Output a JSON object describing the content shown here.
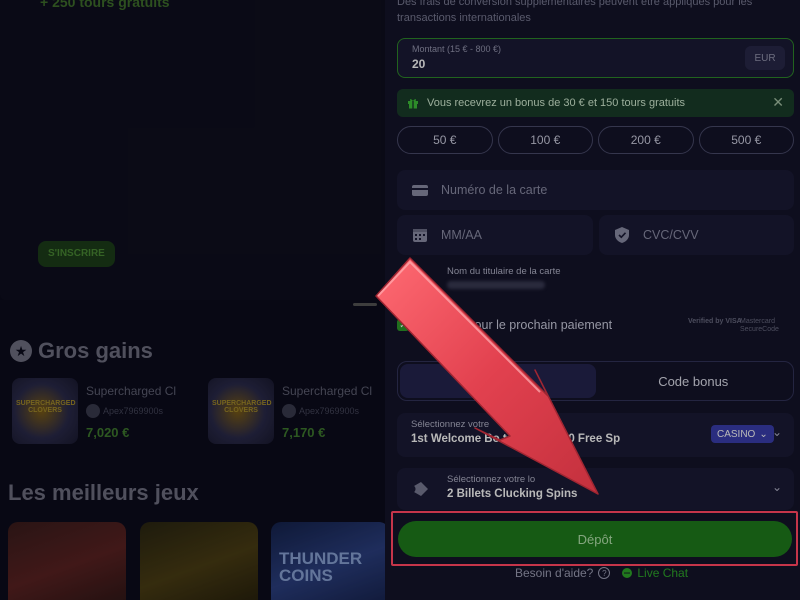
{
  "background": {
    "hero_line": "+ 250 tours gratuits",
    "signup_label": "S'INSCRIRE",
    "big_wins_title": "Gros gains",
    "wins": [
      {
        "name": "Supercharged Cl",
        "user": "Apex7969900s",
        "amount": "7,020 €"
      },
      {
        "name": "Supercharged Cl",
        "user": "Apex7969900s",
        "amount": "7,170 €"
      }
    ],
    "best_games_title": "Les meilleurs jeux",
    "game3_title": "THUNDER COINS"
  },
  "panel": {
    "note": "Des frais de conversion supplémentaires peuvent être appliqués pour les transactions internationales",
    "amount": {
      "label": "Montant (15 € - 800 €)",
      "value": "20",
      "currency": "EUR"
    },
    "bonus_banner": "Vous recevrez un bonus de 30 € et 150 tours gratuits",
    "presets": [
      "50 €",
      "100 €",
      "200 €",
      "500 €"
    ],
    "card_number_placeholder": "Numéro de la carte",
    "expiry_placeholder": "MM/AA",
    "cvc_placeholder": "CVC/CVV",
    "holder_label": "Nom du titulaire de la carte",
    "save_label": "er pour le prochain paiement",
    "verified_by": "Verified by VISA",
    "mc_secure": "Mastercard SecureCode",
    "tabs": [
      {
        "label": "",
        "active": true
      },
      {
        "label": "Code bonus",
        "active": false
      }
    ],
    "bonus_select": {
      "label": "Sélectionnez votre",
      "value": "1st Welcome Bo                    to €150 + 150 Free Sp",
      "badge": "CASINO"
    },
    "lottery_select": {
      "label": "Sélectionnez votre lo",
      "value": "2 Billets Clucking Spins"
    },
    "deposit_label": "Dépôt",
    "help_label": "Besoin d'aide?",
    "live_chat_label": "Live Chat"
  },
  "colors": {
    "accent_green": "#1f7d1c",
    "highlight_red": "#c6354a",
    "arrow_red": "#e2414f"
  }
}
